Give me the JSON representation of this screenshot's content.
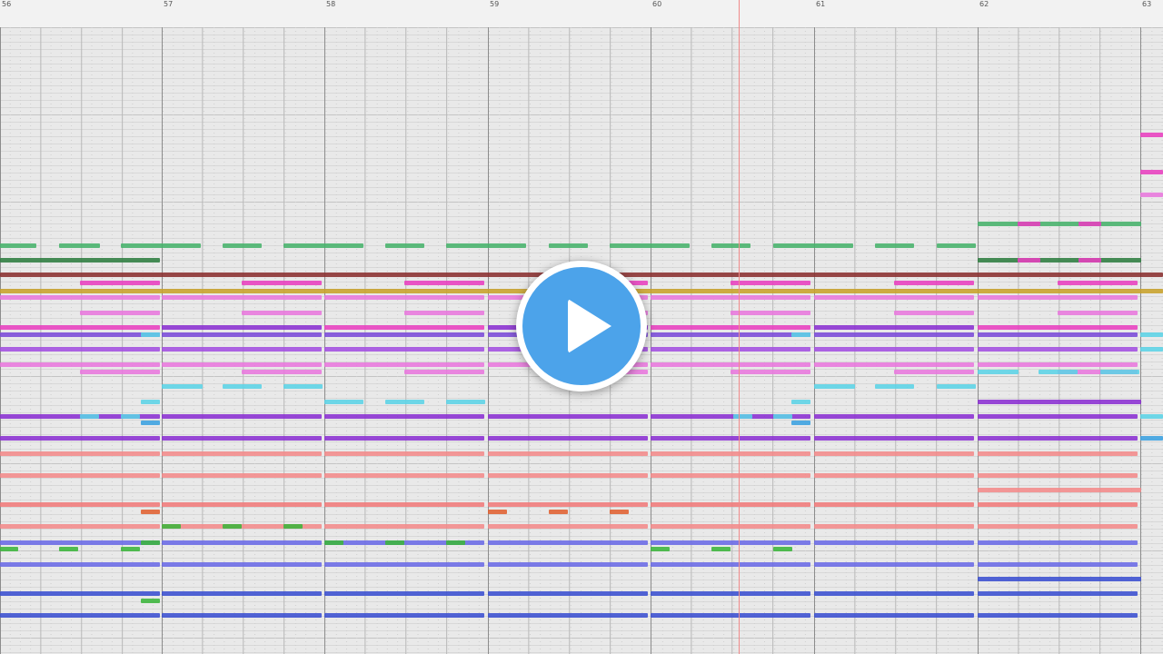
{
  "ruler": {
    "bars": [
      "56",
      "57",
      "58",
      "59",
      "60",
      "61",
      "62",
      "63"
    ]
  },
  "colors": {
    "background": "#e9e9e9",
    "gridline": "#d2d2d2",
    "barline": "#8c8c8c",
    "playhead": "#f08a8a",
    "play_button": "#4ca3ea"
  },
  "notes_palette": [
    "#47b26b",
    "#2e7d40",
    "#8a3030",
    "#c8a22a",
    "#e83fbf",
    "#a24fe0",
    "#5bd3e6",
    "#8a2fd1",
    "#f28a8a",
    "#f07a7a",
    "#e06030",
    "#3bb53b",
    "#6a6ae6",
    "#3a4fd0",
    "#e877dd",
    "#3aa0e0",
    "#7a4ad8"
  ],
  "play_overlay": {
    "icon": "play-icon"
  }
}
